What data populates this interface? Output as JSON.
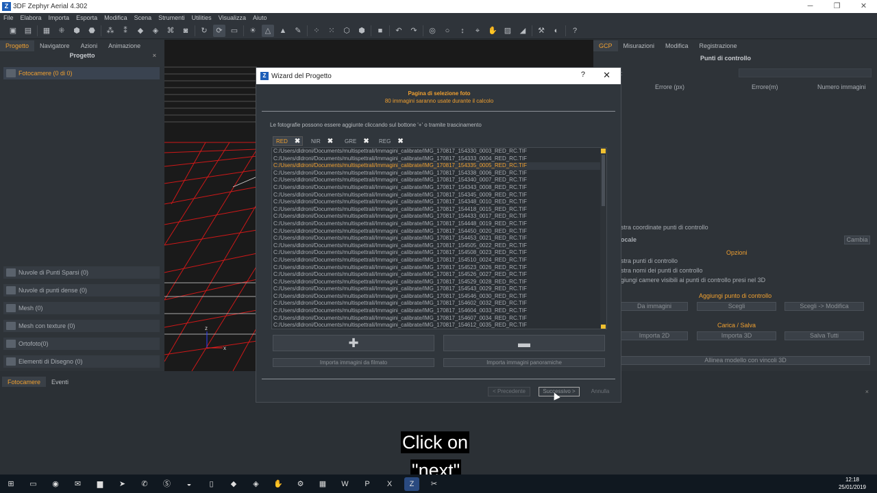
{
  "window": {
    "title": "3DF Zephyr Aerial 4.302",
    "min": "─",
    "max": "❐",
    "close": "✕"
  },
  "menu": [
    "File",
    "Elabora",
    "Importa",
    "Esporta",
    "Modifica",
    "Scena",
    "Strumenti",
    "Utilities",
    "Visualizza",
    "Aiuto"
  ],
  "left": {
    "tabs": [
      "Progetto",
      "Navigatore",
      "Azioni",
      "Animazione"
    ],
    "header": "Progetto",
    "close": "×",
    "items": [
      "Fotocamere (0 di 0)",
      "Nuvole di Punti Sparsi (0)",
      "Nuvole di punti dense (0)",
      "Mesh (0)",
      "Mesh con texture (0)",
      "Ortofoto(0)",
      "Elementi di Disegno (0)"
    ]
  },
  "viewport": {
    "axis_z": "z",
    "axis_x": "x"
  },
  "right": {
    "tabs": [
      "GCP",
      "Misurazioni",
      "Modifica",
      "Registrazione"
    ],
    "header": "Punti di controllo",
    "colon": ":",
    "cols": [
      "Errore (px)",
      "Errore(m)",
      "Numero immagini"
    ],
    "coord_label": "stra coordinate punti di controllo",
    "locale": "ocale",
    "cambia": "Cambia",
    "opzioni": "Opzioni",
    "opt1": "stra punti di controllo",
    "opt2": "stra nomi dei punti di controllo",
    "opt3": "giungi camere visibili ai punti di controllo presi nel 3D",
    "add_section": "Aggiungi punto di controllo",
    "btn_da_immagini": "Da immagini",
    "btn_scegli": "Scegli",
    "btn_scegli_mod": "Scegli -> Modifica",
    "load_section": "Carica / Salva",
    "btn_imp2d": "Importa 2D",
    "btn_imp3d": "Importa 3D",
    "btn_salva": "Salva Tutti",
    "btn_allinea": "Allinea modello con vincoli 3D"
  },
  "bottom": {
    "tabs": [
      "Fotocamere",
      "Eventi"
    ],
    "close": "×"
  },
  "dialog": {
    "title": "Wizard del Progetto",
    "help": "?",
    "close": "✕",
    "heading": "Pagina di selezione foto",
    "subheading": "80 immagini saranno usate durante il calcolo",
    "info": "Le fotografie possono essere aggiunte cliccando sul bottone '+' o tramite trascinamento",
    "tabs": [
      "RED",
      "NIR",
      "GRE",
      "REG"
    ],
    "tab_close": "✖",
    "files": [
      "C:/Users/dldroni/Documents/multispettrali/Immagini_calibrate/IMG_170817_154330_0003_RED_RC.TIF",
      "C:/Users/dldroni/Documents/multispettrali/Immagini_calibrate/IMG_170817_154333_0004_RED_RC.TIF",
      "C:/Users/dldroni/Documents/multispettrali/Immagini_calibrate/IMG_170817_154335_0005_RED_RC.TIF",
      "C:/Users/dldroni/Documents/multispettrali/Immagini_calibrate/IMG_170817_154338_0006_RED_RC.TIF",
      "C:/Users/dldroni/Documents/multispettrali/Immagini_calibrate/IMG_170817_154340_0007_RED_RC.TIF",
      "C:/Users/dldroni/Documents/multispettrali/Immagini_calibrate/IMG_170817_154343_0008_RED_RC.TIF",
      "C:/Users/dldroni/Documents/multispettrali/Immagini_calibrate/IMG_170817_154345_0009_RED_RC.TIF",
      "C:/Users/dldroni/Documents/multispettrali/Immagini_calibrate/IMG_170817_154348_0010_RED_RC.TIF",
      "C:/Users/dldroni/Documents/multispettrali/Immagini_calibrate/IMG_170817_154418_0015_RED_RC.TIF",
      "C:/Users/dldroni/Documents/multispettrali/Immagini_calibrate/IMG_170817_154433_0017_RED_RC.TIF",
      "C:/Users/dldroni/Documents/multispettrali/Immagini_calibrate/IMG_170817_154448_0019_RED_RC.TIF",
      "C:/Users/dldroni/Documents/multispettrali/Immagini_calibrate/IMG_170817_154450_0020_RED_RC.TIF",
      "C:/Users/dldroni/Documents/multispettrali/Immagini_calibrate/IMG_170817_154453_0021_RED_RC.TIF",
      "C:/Users/dldroni/Documents/multispettrali/Immagini_calibrate/IMG_170817_154505_0022_RED_RC.TIF",
      "C:/Users/dldroni/Documents/multispettrali/Immagini_calibrate/IMG_170817_154508_0023_RED_RC.TIF",
      "C:/Users/dldroni/Documents/multispettrali/Immagini_calibrate/IMG_170817_154510_0024_RED_RC.TIF",
      "C:/Users/dldroni/Documents/multispettrali/Immagini_calibrate/IMG_170817_154523_0026_RED_RC.TIF",
      "C:/Users/dldroni/Documents/multispettrali/Immagini_calibrate/IMG_170817_154526_0027_RED_RC.TIF",
      "C:/Users/dldroni/Documents/multispettrali/Immagini_calibrate/IMG_170817_154529_0028_RED_RC.TIF",
      "C:/Users/dldroni/Documents/multispettrali/Immagini_calibrate/IMG_170817_154543_0029_RED_RC.TIF",
      "C:/Users/dldroni/Documents/multispettrali/Immagini_calibrate/IMG_170817_154546_0030_RED_RC.TIF",
      "C:/Users/dldroni/Documents/multispettrali/Immagini_calibrate/IMG_170817_154602_0032_RED_RC.TIF",
      "C:/Users/dldroni/Documents/multispettrali/Immagini_calibrate/IMG_170817_154604_0033_RED_RC.TIF",
      "C:/Users/dldroni/Documents/multispettrali/Immagini_calibrate/IMG_170817_154607_0034_RED_RC.TIF",
      "C:/Users/dldroni/Documents/multispettrali/Immagini_calibrate/IMG_170817_154612_0035_RED_RC.TIF"
    ],
    "add_symbol": "✚",
    "remove_symbol": "▬",
    "btn_import_video": "Importa immagini da filmato",
    "btn_import_pano": "Importa immagini panoramiche",
    "btn_prev": "< Precedente",
    "btn_next": "Successivo >",
    "btn_cancel": "Annulla"
  },
  "caption": {
    "line1": "Click on",
    "line2": "\"next\""
  },
  "taskbar": {
    "time": "12:18",
    "date": "25/01/2019"
  },
  "colors": {
    "accent": "#f0a030",
    "bg": "#2b3035"
  }
}
